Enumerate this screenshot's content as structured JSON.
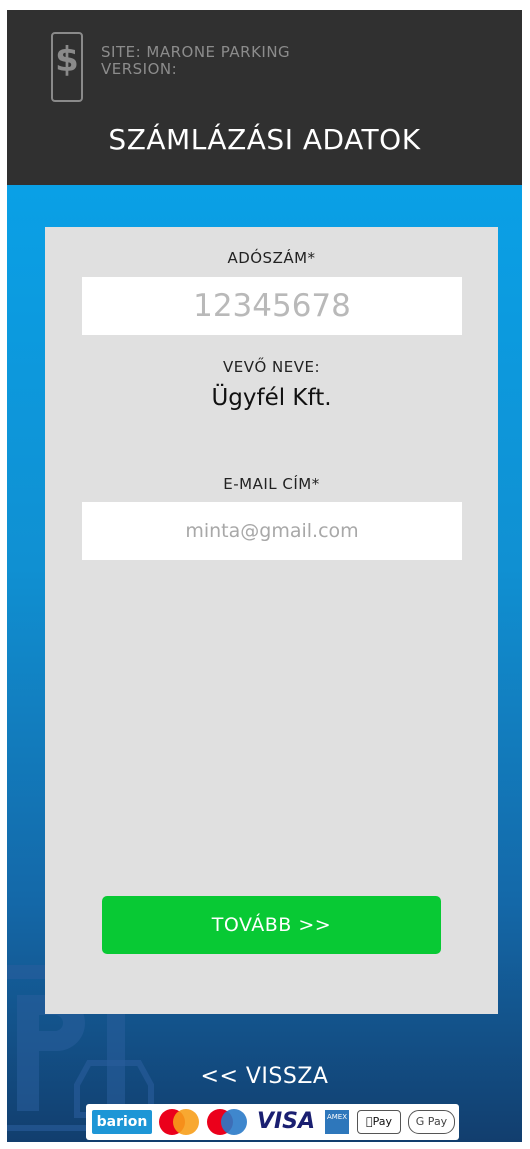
{
  "header": {
    "logo_icon": "dollar-phone-icon",
    "site_line": "SITE: MARONE PARKING",
    "version_line": "VERSION:",
    "title": "SZÁMLÁZÁSI ADATOK"
  },
  "form": {
    "tax_label": "ADÓSZÁM*",
    "tax_placeholder": "12345678",
    "tax_value": "",
    "customer_label": "VEVŐ NEVE:",
    "customer_name": "Ügyfél Kft.",
    "email_label": "E-MAIL CÍM*",
    "email_placeholder": "minta@gmail.com",
    "email_value": "",
    "next_label": "TOVÁBB >>"
  },
  "footer": {
    "back_label": "<< VISSZA",
    "payments": {
      "barion": "barion",
      "visa": "VISA",
      "amex": "AMEX",
      "applepay": "Pay",
      "gpay": "G Pay"
    }
  },
  "colors": {
    "header_bg": "#303030",
    "main_bg": "#0aa0e6",
    "card_bg": "#e0e0e0",
    "next_button": "#08c934"
  }
}
